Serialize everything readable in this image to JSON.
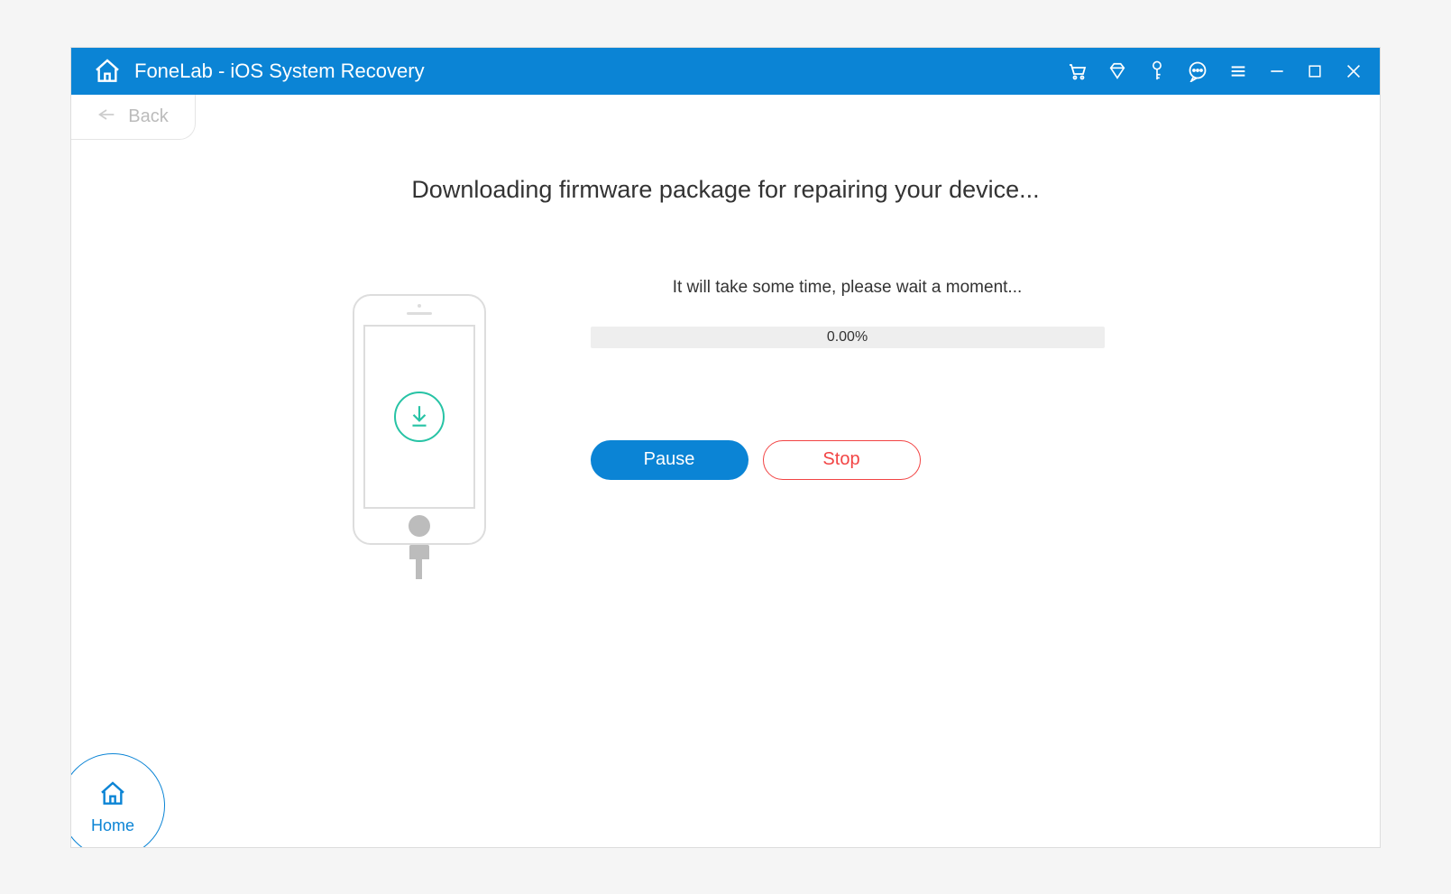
{
  "titlebar": {
    "appTitle": "FoneLab - iOS System Recovery"
  },
  "nav": {
    "backLabel": "Back"
  },
  "content": {
    "heading": "Downloading firmware package for repairing your device...",
    "waitMessage": "It will take some time, please wait a moment...",
    "progressPercent": "0.00%"
  },
  "buttons": {
    "pause": "Pause",
    "stop": "Stop"
  },
  "home": {
    "label": "Home"
  }
}
